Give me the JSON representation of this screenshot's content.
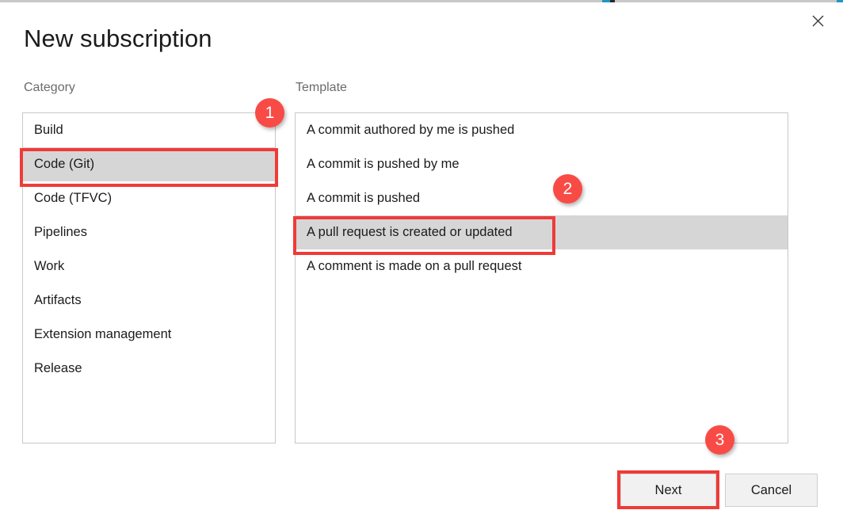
{
  "dialog": {
    "title": "New subscription",
    "close_icon": "close-icon"
  },
  "category": {
    "label": "Category",
    "items": [
      {
        "label": "Build",
        "selected": false
      },
      {
        "label": "Code (Git)",
        "selected": true
      },
      {
        "label": "Code (TFVC)",
        "selected": false
      },
      {
        "label": "Pipelines",
        "selected": false
      },
      {
        "label": "Work",
        "selected": false
      },
      {
        "label": "Artifacts",
        "selected": false
      },
      {
        "label": "Extension management",
        "selected": false
      },
      {
        "label": "Release",
        "selected": false
      }
    ]
  },
  "template": {
    "label": "Template",
    "items": [
      {
        "label": "A commit authored by me is pushed",
        "selected": false
      },
      {
        "label": "A commit is pushed by me",
        "selected": false
      },
      {
        "label": "A commit is pushed",
        "selected": false
      },
      {
        "label": "A pull request is created or updated",
        "selected": true
      },
      {
        "label": "A comment is made on a pull request",
        "selected": false
      }
    ]
  },
  "footer": {
    "next_label": "Next",
    "cancel_label": "Cancel"
  },
  "annotations": {
    "badges": [
      {
        "number": "1",
        "target": "category-item-code-git"
      },
      {
        "number": "2",
        "target": "template-item-pull-request"
      },
      {
        "number": "3",
        "target": "next-button"
      }
    ],
    "color": "#f94b46",
    "box_color": "#ef3b38"
  },
  "colors": {
    "selection_background": "#d6d6d6",
    "button_background": "#f1f1f1",
    "border": "#c8c8c8",
    "label_text": "#6b6b6b",
    "body_text": "#1b1b1b"
  }
}
